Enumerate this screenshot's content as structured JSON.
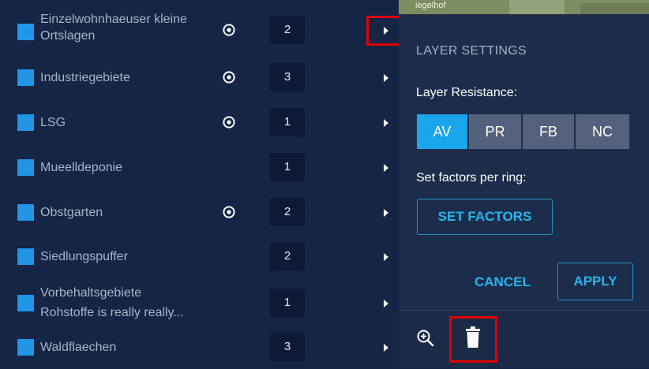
{
  "layers": [
    {
      "name_line1": "Einzelwohnhaeuser kleine",
      "name_line2": "Ortslagen",
      "visible_icon": true,
      "count": "2"
    },
    {
      "name_line1": "Industriegebiete",
      "name_line2": "",
      "visible_icon": true,
      "count": "3"
    },
    {
      "name_line1": "LSG",
      "name_line2": "",
      "visible_icon": true,
      "count": "1"
    },
    {
      "name_line1": "Mueelldeponie",
      "name_line2": "",
      "visible_icon": false,
      "count": "1"
    },
    {
      "name_line1": "Obstgarten",
      "name_line2": "",
      "visible_icon": true,
      "count": "2"
    },
    {
      "name_line1": "Siedlungspuffer",
      "name_line2": "",
      "visible_icon": false,
      "count": "2"
    },
    {
      "name_line1": "Vorbehaltsgebiete",
      "name_line2": "Rohstoffe is really really...",
      "visible_icon": false,
      "count": "1"
    },
    {
      "name_line1": "Waldflaechen",
      "name_line2": "",
      "visible_icon": false,
      "count": "3"
    }
  ],
  "map_label": "iegelhof",
  "settings": {
    "title": "LAYER SETTINGS",
    "resistance_label": "Layer Resistance:",
    "resistance_options": [
      "AV",
      "PR",
      "FB",
      "NC"
    ],
    "resistance_selected": "AV",
    "factors_label": "Set factors per ring:",
    "set_factors_button": "SET FACTORS",
    "cancel_button": "CANCEL",
    "apply_button": "APPLY"
  },
  "toolbar": {
    "zoom_icon": "zoom-in-icon",
    "delete_icon": "trash-icon"
  },
  "colors": {
    "accent": "#1ba6ec",
    "highlight": "#e00000",
    "layer_swatch": "#2196e8"
  }
}
